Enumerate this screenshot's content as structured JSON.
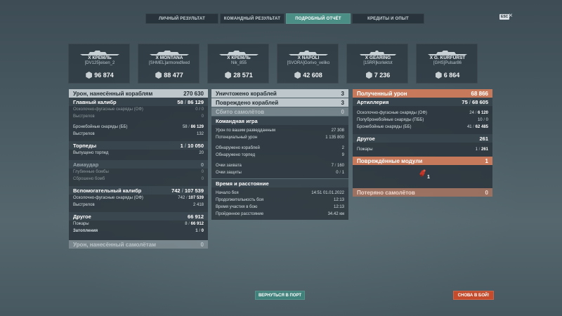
{
  "tabs": [
    "ЛИЧНЫЙ РЕЗУЛЬТАТ",
    "КОМАНДНЫЙ РЕЗУЛЬТАТ",
    "ПОДРОБНЫЙ ОТЧЁТ",
    "КРЕДИТЫ И ОПЫТ"
  ],
  "esc_label": "ESC",
  "close_glyph": "×",
  "ships": [
    {
      "name": "X КРЕМЛЬ",
      "player": "[DV125]eisen_2",
      "damage": "96 874"
    },
    {
      "name": "X MONTANA",
      "player": "[SHMEL]armoredfeed",
      "damage": "88 477"
    },
    {
      "name": "X КРЕМЛЬ",
      "player": "Nik_855",
      "damage": "28 571"
    },
    {
      "name": "X NAPOLI",
      "player": "[SVORA]Gorivo_veliko",
      "damage": "42 608"
    },
    {
      "name": "X GEARING",
      "player": "[15RR]korlektot",
      "damage": "7 236"
    },
    {
      "name": "X G. KURFÜRST",
      "player": "[GHS]Pulsar86",
      "damage": "6 864"
    }
  ],
  "left": {
    "damage_header": {
      "label": "Урон, нанесённый кораблям",
      "value": "270 630"
    },
    "main": {
      "label": "Главный калибр",
      "hits": "58",
      "total": "86 129",
      "he_label": "Осколочно-фугасные снаряды (ОФ)",
      "he_hits": "0",
      "he_dmg": "0",
      "he_shots_label": "Выстрелов",
      "he_shots": "0",
      "ap_label": "Бронебойные снаряды (ББ)",
      "ap_hits": "58",
      "ap_dmg": "86 129",
      "ap_shots_label": "Выстрелов",
      "ap_shots": "132"
    },
    "torpedo": {
      "label": "Торпеды",
      "hits": "1",
      "dmg": "10 050",
      "launched_label": "Выпущено торпед",
      "launched": "20"
    },
    "air": {
      "label": "Авиаудар",
      "value": "0",
      "depth_label": "Глубинные бомбы",
      "depth_a": "0",
      "bombs_label": "Сброшено бомб",
      "bombs_a": "0"
    },
    "secondary": {
      "label": "Вспомогательный калибр",
      "hits": "742",
      "dmg": "107 539",
      "he_label": "Осколочно-фугасные снаряды (ОФ)",
      "he_hits": "742",
      "he_dmg": "107 539",
      "shots_label": "Выстрелов",
      "shots": "2 418"
    },
    "other": {
      "label": "Другое",
      "value": "66 912",
      "fire_label": "Пожары",
      "fire_n": "8",
      "fire_dmg": "66 912",
      "flood_label": "Затопления",
      "flood_n": "1",
      "flood_dmg": "0"
    },
    "aircraft_damage": {
      "label": "Урон, нанесённый самолётам",
      "value": "0"
    }
  },
  "middle": {
    "destroyed": {
      "label": "Уничтожено кораблей",
      "value": "3"
    },
    "damaged": {
      "label": "Повреждено кораблей",
      "value": "3"
    },
    "planes": {
      "label": "Сбито самолётов",
      "value": "0"
    },
    "team": {
      "label": "Командная игра",
      "spotted_dmg_label": "Урон по вашим разведданным",
      "spotted_dmg": "27 308",
      "potential_label": "Потенциальный урон",
      "potential": "1 135 800",
      "ships_spotted_label": "Обнаружено кораблей",
      "ships_spotted": "2",
      "torps_spotted_label": "Обнаружено торпед",
      "torps_spotted": "9",
      "capture_label": "Очки захвата",
      "capture_a": "7",
      "capture_b": "160",
      "defense_label": "Очки защиты",
      "defense_a": "0",
      "defense_b": "1"
    },
    "time": {
      "label": "Время и расстояние",
      "start_label": "Начало боя",
      "start": "14:51  01.01.2022",
      "duration_label": "Продолжительность боя",
      "duration": "12:13",
      "participation_label": "Время участия в бою",
      "participation": "12:13",
      "distance_label": "Пройденное расстояние",
      "distance": "34.42 км"
    }
  },
  "right": {
    "received": {
      "label": "Полученный урон",
      "value": "68 866"
    },
    "artillery": {
      "label": "Артиллерия",
      "hits": "75",
      "dmg": "68 605",
      "he_label": "Осколочно-фугасные снаряды (ОФ)",
      "he_hits": "24",
      "he_dmg": "6 120",
      "sap_label": "Полубронебойные снаряды (ПББ)",
      "sap_hits": "10",
      "sap_dmg": "0",
      "ap_label": "Бронебойные снаряды (ББ)",
      "ap_hits": "41",
      "ap_dmg": "62 485"
    },
    "other": {
      "label": "Другое",
      "value": "261",
      "fire_label": "Пожары",
      "fire_n": "1",
      "fire_dmg": "261"
    },
    "modules": {
      "label": "Повреждённые модули",
      "value": "1",
      "icon_count": "1",
      "icon": "flooding-icon"
    },
    "lost_planes": {
      "label": "Потеряно самолётов",
      "value": "0"
    }
  },
  "buttons": {
    "port": "ВЕРНУТЬСЯ В ПОРТ",
    "battle": "СНОВА В БОЙ!"
  },
  "colors": {
    "accent": "#4a8e86",
    "battle": "#c44c2c",
    "received": "#c67a5b"
  }
}
